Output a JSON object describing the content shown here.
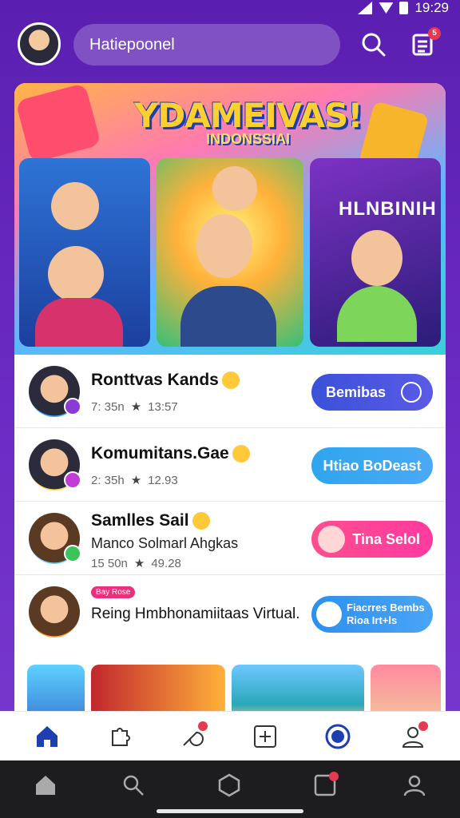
{
  "status_bar": {
    "time": "19:29"
  },
  "header": {
    "search_text": "Hatiepoonel",
    "notifications_badge": "5"
  },
  "banner": {
    "title": "YDAMEIVAS!",
    "subtitle": "INDONSSIAI",
    "panel_3_label": "HLNBINIH"
  },
  "list": [
    {
      "title": "Ronttvas Kands",
      "meta_left": "7: 35n",
      "meta_right": "13:57",
      "button": "Bemibas"
    },
    {
      "title": "Komumitans.Gae",
      "meta_left": "2: 35h",
      "meta_right": "12.93",
      "button": "Htiao BoDeast"
    },
    {
      "title": "Samlles Sail",
      "subtitle": "Manco Solmarl Ahgkas",
      "meta_left": "15 50n",
      "meta_right": "49.28",
      "button": "Tina Selol"
    },
    {
      "tag": "Bay Rose",
      "title": "Reing Hmbhonamiitaas Virtual.",
      "button_line1": "Fiacrres Bembs",
      "button_line2": "Rioa Irt+ls"
    }
  ],
  "colors": {
    "background": "#6b2bc4",
    "accent_blue": "#3a52d8",
    "accent_pink": "#ff3aa0",
    "tab_active": "#1e3fb0"
  }
}
